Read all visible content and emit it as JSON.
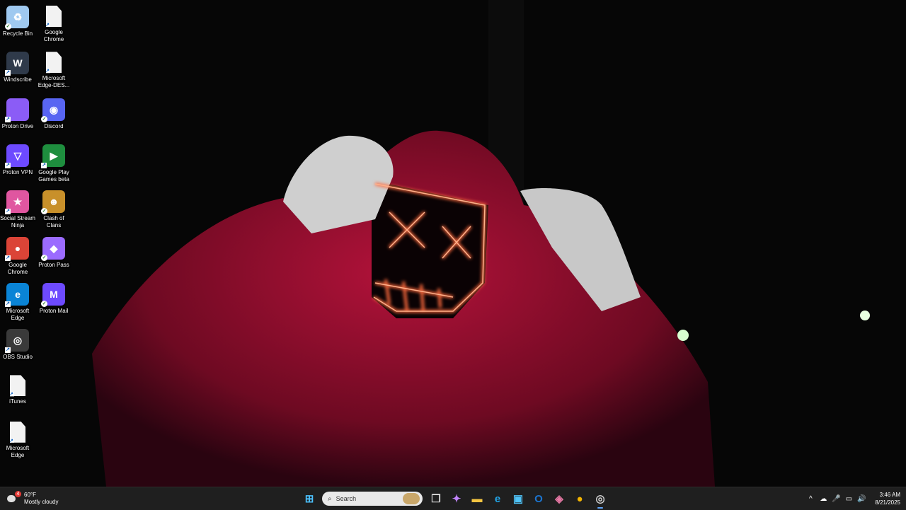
{
  "desktop_icons": [
    {
      "label": "Recycle Bin",
      "icon": "recycle-bin-icon",
      "symbol": "♻",
      "color": "#9fc9f0"
    },
    {
      "label": "Google Chrome",
      "icon": "file-icon",
      "symbol": "",
      "color": "#e8eef5"
    },
    {
      "label": "Windscribe",
      "icon": "windscribe-icon",
      "symbol": "W",
      "color": "#2f3a4a"
    },
    {
      "label": "Microsoft Edge-DES...",
      "icon": "file-icon",
      "symbol": "",
      "color": "#f2f2f2"
    },
    {
      "label": "Proton Drive",
      "icon": "proton-drive-icon",
      "symbol": "",
      "color": "#8b5cf6"
    },
    {
      "label": "Discord",
      "icon": "discord-icon",
      "symbol": "◉",
      "color": "#5865f2"
    },
    {
      "label": "Proton VPN",
      "icon": "proton-vpn-icon",
      "symbol": "▽",
      "color": "#6d4aff"
    },
    {
      "label": "Google Play Games beta",
      "icon": "google-play-games-icon",
      "symbol": "▶",
      "color": "#1e8e3e"
    },
    {
      "label": "Social Stream Ninja",
      "icon": "social-stream-ninja-icon",
      "symbol": "★",
      "color": "#e056a0"
    },
    {
      "label": "Clash of Clans",
      "icon": "clash-of-clans-icon",
      "symbol": "☻",
      "color": "#c8902a"
    },
    {
      "label": "Google Chrome",
      "icon": "chrome-icon",
      "symbol": "●",
      "color": "#db4437"
    },
    {
      "label": "Proton Pass",
      "icon": "proton-pass-icon",
      "symbol": "◆",
      "color": "#9b6bff"
    },
    {
      "label": "Microsoft Edge",
      "icon": "edge-icon",
      "symbol": "e",
      "color": "#0a84d6"
    },
    {
      "label": "Proton Mail",
      "icon": "proton-mail-icon",
      "symbol": "M",
      "color": "#6d4aff"
    },
    {
      "label": "OBS Studio",
      "icon": "obs-studio-icon",
      "symbol": "◎",
      "color": "#3a3a3a"
    },
    {
      "label": "iTunes",
      "icon": "file-icon",
      "symbol": "",
      "color": "#f2f2f2"
    },
    {
      "label": "Microsoft Edge",
      "icon": "file-icon",
      "symbol": "",
      "color": "#f2f2f2"
    }
  ],
  "taskbar": {
    "weather": {
      "temp": "60°F",
      "condition": "Mostly cloudy",
      "badge": "4"
    },
    "search_placeholder": "Search",
    "pinned": [
      {
        "name": "start-button",
        "icon": "windows-start-icon",
        "symbol": "⊞",
        "color": "#4cc2ff"
      },
      {
        "name": "search-box"
      },
      {
        "name": "task-view-button",
        "icon": "task-view-icon",
        "symbol": "❐",
        "color": "#d0d0d0"
      },
      {
        "name": "copilot-button",
        "icon": "copilot-icon",
        "symbol": "✦",
        "color": "#c084fc"
      },
      {
        "name": "file-explorer-button",
        "icon": "folder-icon",
        "symbol": "▬",
        "color": "#f5c542"
      },
      {
        "name": "edge-button",
        "icon": "edge-icon",
        "symbol": "e",
        "color": "#22a6e8"
      },
      {
        "name": "store-button",
        "icon": "store-icon",
        "symbol": "▣",
        "color": "#4fc3f7"
      },
      {
        "name": "outlook-button",
        "icon": "outlook-icon",
        "symbol": "O",
        "color": "#1b75d0"
      },
      {
        "name": "m365-button",
        "icon": "microsoft-365-icon",
        "symbol": "◈",
        "color": "#e879a6"
      },
      {
        "name": "chrome-button",
        "icon": "chrome-icon",
        "symbol": "●",
        "color": "#f4b400"
      },
      {
        "name": "obs-button",
        "icon": "obs-studio-icon",
        "symbol": "◎",
        "color": "#d0d0d0"
      }
    ],
    "tray": {
      "icons": [
        {
          "name": "show-hidden-icons",
          "symbol": "^"
        },
        {
          "name": "onedrive-icon",
          "symbol": "☁"
        },
        {
          "name": "microphone-icon",
          "symbol": "🎤"
        },
        {
          "name": "network-icon",
          "symbol": "▭"
        },
        {
          "name": "volume-icon",
          "symbol": "🔊"
        }
      ],
      "time": "3:46 AM",
      "date": "8/21/2025"
    }
  }
}
